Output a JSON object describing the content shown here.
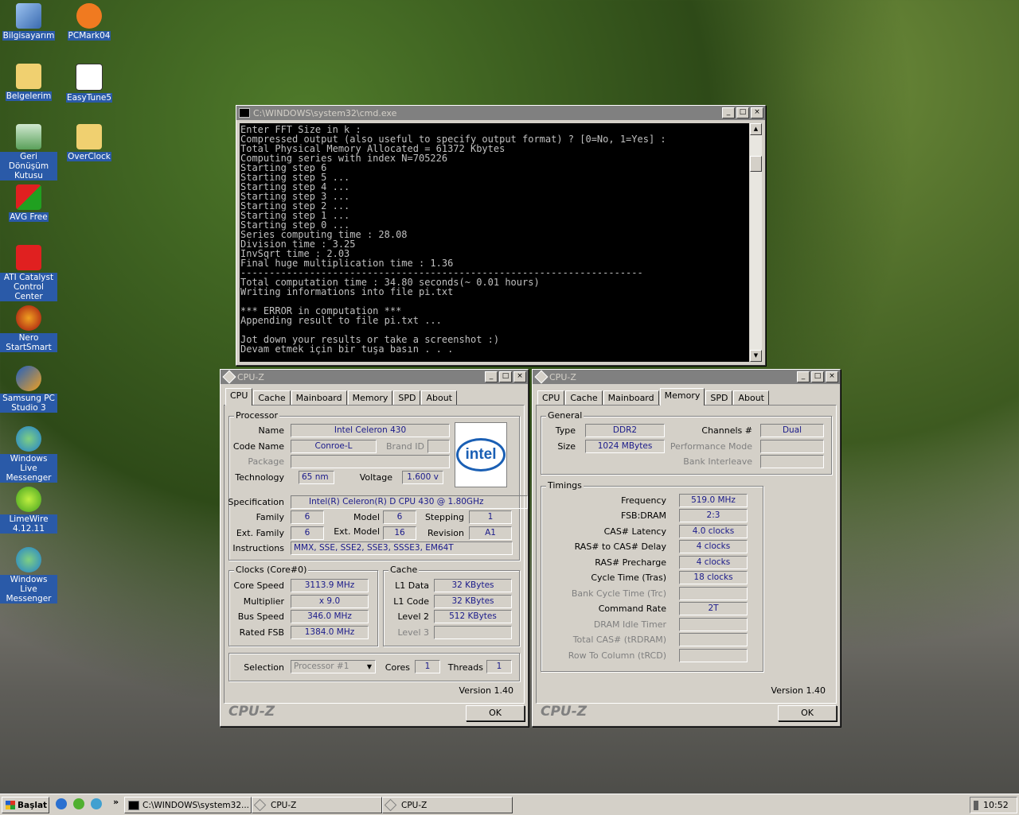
{
  "desktop_icons": [
    {
      "label": "Bilgisayarım",
      "icon": "computer-icon"
    },
    {
      "label": "PCMark04",
      "icon": "pcmark-icon"
    },
    {
      "label": "Belgelerim",
      "icon": "folder-icon"
    },
    {
      "label": "EasyTune5",
      "icon": "gigabyte-icon"
    },
    {
      "label": "Geri Dönüşüm Kutusu",
      "icon": "recycle-bin-icon"
    },
    {
      "label": "OverClock",
      "icon": "folder-icon"
    },
    {
      "label": "AVG Free",
      "icon": "avg-icon"
    },
    {
      "label": "ATI Catalyst Control Center",
      "icon": "ati-icon"
    },
    {
      "label": "Nero StartSmart",
      "icon": "nero-icon"
    },
    {
      "label": "Samsung PC Studio 3",
      "icon": "samsung-icon"
    },
    {
      "label": "Windows Live Messenger",
      "icon": "messenger-icon"
    },
    {
      "label": "LimeWire 4.12.11",
      "icon": "limewire-icon"
    },
    {
      "label": "Windows Live Messenger",
      "icon": "messenger-icon"
    }
  ],
  "cmd": {
    "title": "C:\\WINDOWS\\system32\\cmd.exe",
    "text": "Enter FFT Size in k :\nCompressed output (also useful to specify output format) ? [0=No, 1=Yes] :\nTotal Physical Memory Allocated = 61372 Kbytes\nComputing series with index N=705226\nStarting step 6\nStarting step 5 ...\nStarting step 4 ...\nStarting step 3 ...\nStarting step 2 ...\nStarting step 1 ...\nStarting step 0 ...\nSeries computing time : 28.08\nDivision time : 3.25\nInvSqrt time : 2.03\nFinal huge multiplication time : 1.36\n----------------------------------------------------------------------\nTotal computation time : 34.80 seconds(~ 0.01 hours)\nWriting informations into file pi.txt\n\n*** ERROR in computation ***\nAppending result to file pi.txt ...\n\nJot down your results or take a screenshot :)\nDevam etmek için bir tuşa basın . . ."
  },
  "cpuz_tabs": [
    "CPU",
    "Cache",
    "Mainboard",
    "Memory",
    "SPD",
    "About"
  ],
  "cpuz1": {
    "title": "CPU-Z",
    "processor_title": "Processor",
    "name_label": "Name",
    "name": "Intel Celeron 430",
    "codename_label": "Code Name",
    "codename": "Conroe-L",
    "brandid_label": "Brand ID",
    "brandid": "",
    "package_label": "Package",
    "package": "",
    "tech_label": "Technology",
    "tech": "65 nm",
    "voltage_label": "Voltage",
    "voltage": "1.600 v",
    "spec_label": "Specification",
    "spec": "Intel(R) Celeron(R) D CPU     430  @ 1.80GHz",
    "family_label": "Family",
    "family": "6",
    "model_label": "Model",
    "model": "6",
    "stepping_label": "Stepping",
    "stepping": "1",
    "extfamily_label": "Ext. Family",
    "extfamily": "6",
    "extmodel_label": "Ext. Model",
    "extmodel": "16",
    "revision_label": "Revision",
    "revision": "A1",
    "instr_label": "Instructions",
    "instr": "MMX, SSE, SSE2, SSE3, SSSE3, EM64T",
    "logo": "intel",
    "clocks_title": "Clocks (Core#0)",
    "corespeed_label": "Core Speed",
    "corespeed": "3113.9 MHz",
    "mult_label": "Multiplier",
    "mult": "x 9.0",
    "bus_label": "Bus Speed",
    "bus": "346.0 MHz",
    "fsb_label": "Rated FSB",
    "fsb": "1384.0 MHz",
    "cache_title": "Cache",
    "l1d_label": "L1 Data",
    "l1d": "32 KBytes",
    "l1c_label": "L1 Code",
    "l1c": "32 KBytes",
    "l2_label": "Level 2",
    "l2": "512 KBytes",
    "l3_label": "Level 3",
    "l3": "",
    "selection_label": "Selection",
    "selection": "Processor #1",
    "cores_label": "Cores",
    "cores": "1",
    "threads_label": "Threads",
    "threads": "1",
    "version": "Version 1.40",
    "brand": "CPU-Z",
    "ok": "OK"
  },
  "cpuz2": {
    "title": "CPU-Z",
    "general_title": "General",
    "type_label": "Type",
    "type": "DDR2",
    "channels_label": "Channels #",
    "channels": "Dual",
    "size_label": "Size",
    "size": "1024 MBytes",
    "perfmode_label": "Performance Mode",
    "perfmode": "",
    "bankint_label": "Bank Interleave",
    "bankint": "",
    "timings_title": "Timings",
    "freq_label": "Frequency",
    "freq": "519.0 MHz",
    "fsbdram_label": "FSB:DRAM",
    "fsbdram": "2:3",
    "cas_label": "CAS# Latency",
    "cas": "4.0 clocks",
    "rcd_label": "RAS# to CAS# Delay",
    "rcd": "4 clocks",
    "rp_label": "RAS# Precharge",
    "rp": "4 clocks",
    "tras_label": "Cycle Time (Tras)",
    "tras": "18 clocks",
    "trc_label": "Bank Cycle Time (Trc)",
    "trc": "",
    "cr_label": "Command Rate",
    "cr": "2T",
    "idle_label": "DRAM Idle Timer",
    "idle": "",
    "trdram_label": "Total CAS# (tRDRAM)",
    "trdram": "",
    "trcd_label": "Row To Column (tRCD)",
    "trcd": "",
    "version": "Version 1.40",
    "brand": "CPU-Z",
    "ok": "OK"
  },
  "taskbar": {
    "start": "Başlat",
    "tasks": [
      "C:\\WINDOWS\\system32...",
      "CPU-Z",
      "CPU-Z"
    ],
    "clock": "10:52"
  }
}
